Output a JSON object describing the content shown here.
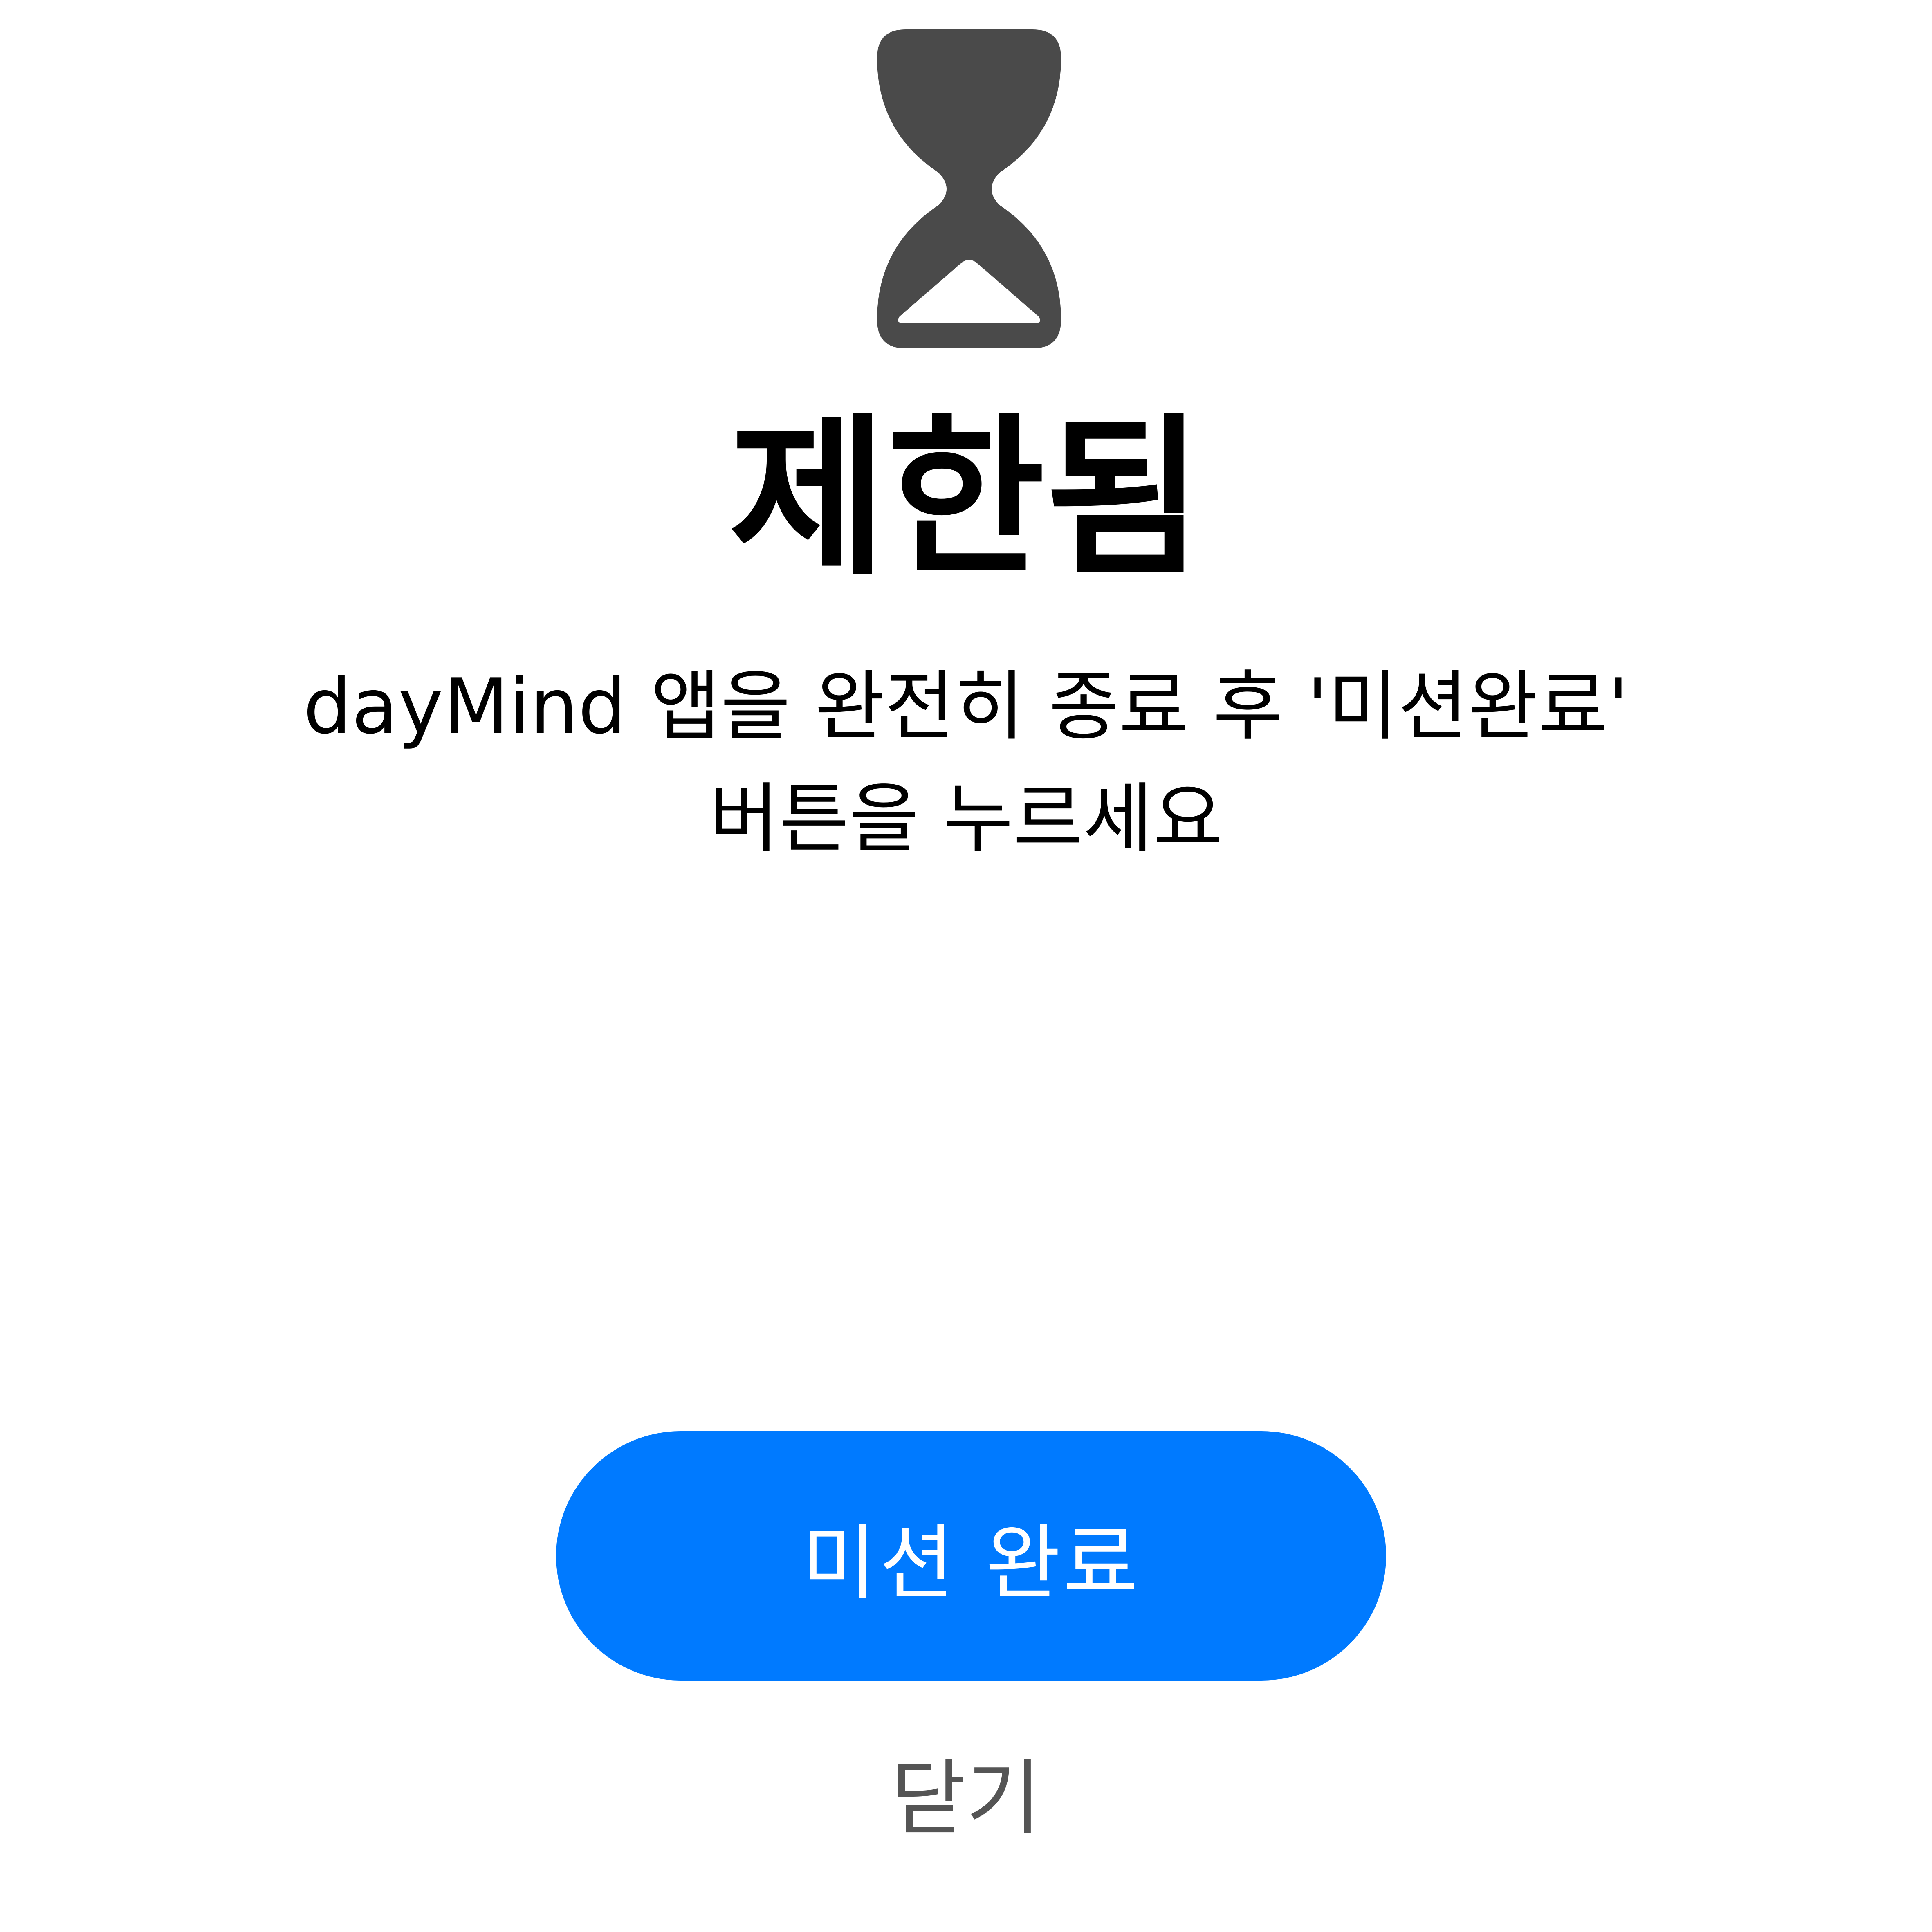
{
  "restricted_screen": {
    "icon": "hourglass-icon",
    "title": "제한됨",
    "message_lines": [
      "dayMind 앱을 완전히 종료 후 '미션완료'",
      "버튼을 누르세요"
    ],
    "primary_button": {
      "label": "미션 완료"
    },
    "close_button": {
      "label": "닫기"
    }
  },
  "colors": {
    "icon": "#4a4a4a",
    "title_text": "#000000",
    "body_text": "#000000",
    "accent": "#007aff",
    "button_text": "#ffffff",
    "secondary_text": "#555555",
    "background": "#ffffff"
  }
}
